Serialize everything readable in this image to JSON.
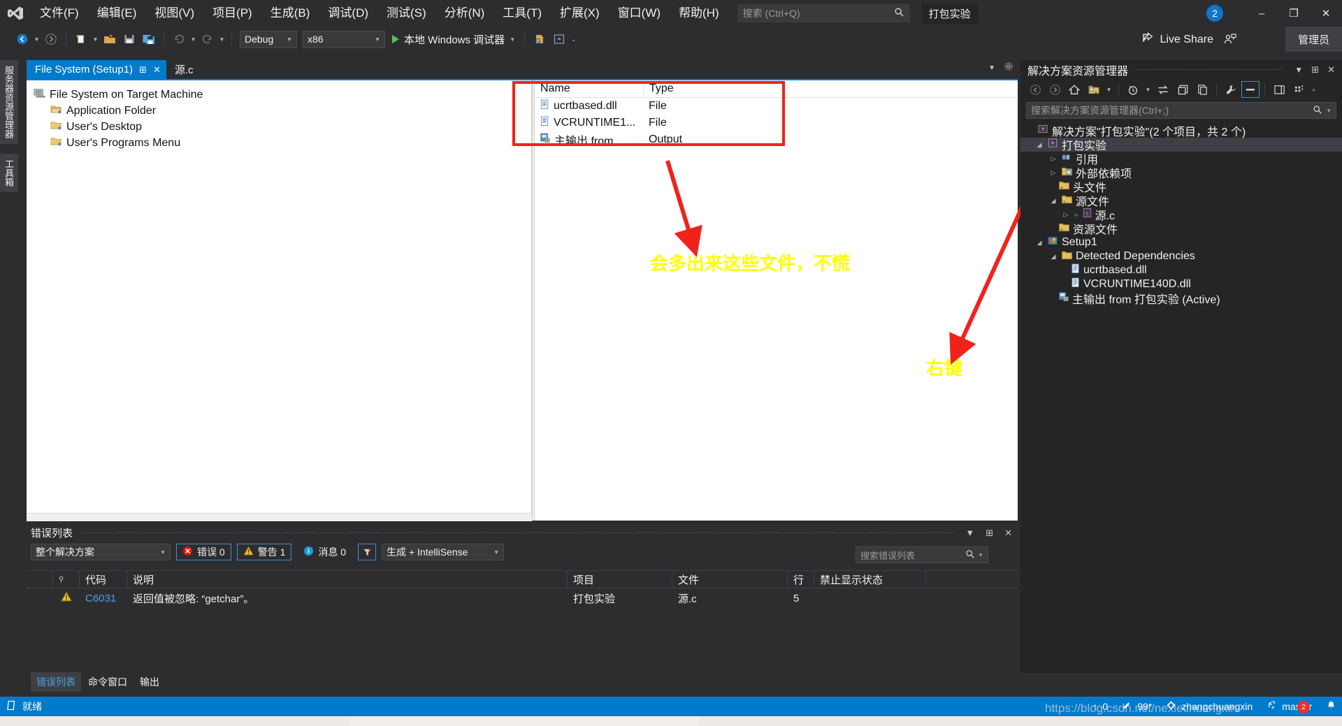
{
  "titlebar": {
    "logo": "vs-logo-icon",
    "menus": [
      "文件(F)",
      "编辑(E)",
      "视图(V)",
      "项目(P)",
      "生成(B)",
      "调试(D)",
      "测试(S)",
      "分析(N)",
      "工具(T)",
      "扩展(X)",
      "窗口(W)",
      "帮助(H)"
    ],
    "search_placeholder": "搜索 (Ctrl+Q)",
    "project_title": "打包实验",
    "notification_count": "2",
    "minimize": "–",
    "maximize": "❐",
    "close": "✕"
  },
  "toolbar": {
    "nav_back": "back-icon",
    "nav_forward": "forward-icon",
    "new_item": "new-item-icon",
    "open_file": "open-folder-icon",
    "save": "save-icon",
    "save_all": "save-all-icon",
    "undo": "undo-icon",
    "redo": "redo-icon",
    "config": "Debug",
    "platform": "x86",
    "run_label": "本地 Windows 调试器",
    "live_share": "Live Share",
    "admin": "管理员"
  },
  "vertical_tabs": [
    "服务器资源管理器",
    "工具箱"
  ],
  "document_tabs": [
    {
      "label": "File System (Setup1)",
      "active": true
    },
    {
      "label": "源.c",
      "active": false
    }
  ],
  "designer": {
    "tree": [
      {
        "label": "File System on Target Machine",
        "icon": "computer-icon",
        "indent": 0
      },
      {
        "label": "Application Folder",
        "icon": "folder-open-icon",
        "indent": 1
      },
      {
        "label": "User's Desktop",
        "icon": "folder-icon",
        "indent": 1
      },
      {
        "label": "User's Programs Menu",
        "icon": "folder-icon",
        "indent": 1
      }
    ],
    "list_headers": [
      "Name",
      "Type"
    ],
    "list_rows": [
      {
        "name": "ucrtbased.dll",
        "type": "File",
        "icon": "file-icon"
      },
      {
        "name": "VCRUNTIME1...",
        "type": "File",
        "icon": "file-icon"
      },
      {
        "name": "主输出 from ...",
        "type": "Output",
        "icon": "output-icon"
      }
    ]
  },
  "annotations": [
    {
      "text": "会多出来这些文件，不慌",
      "color": "#ffff00"
    },
    {
      "text": "右键",
      "color": "#ffff00"
    }
  ],
  "error_list": {
    "title": "错误列表",
    "scope": "整个解决方案",
    "errors_label": "错误 0",
    "warnings_label": "警告 1",
    "messages_label": "消息 0",
    "build_filter": "生成 + IntelliSense",
    "search_placeholder": "搜索错误列表",
    "columns": [
      "",
      "",
      "代码",
      "说明",
      "项目",
      "文件",
      "行",
      "禁止显示状态"
    ],
    "rows": [
      {
        "severity": "warning-icon",
        "code": "C6031",
        "description": "返回值被忽略: “getchar”。",
        "project": "打包实验",
        "file": "源.c",
        "line": "5",
        "suppression": ""
      }
    ],
    "bottom_tabs": [
      "错误列表",
      "命令窗口",
      "输出"
    ]
  },
  "solution_explorer": {
    "title": "解决方案资源管理器",
    "search_placeholder": "搜索解决方案资源管理器(Ctrl+;)",
    "toolbar_icons": [
      "back-icon",
      "forward-icon",
      "home-icon",
      "new-folder-icon",
      "pending-changes-icon",
      "sync-icon",
      "collapse-all-icon",
      "copy-icon",
      "properties-icon",
      "show-all-files-icon",
      "preview-icon",
      "view-options-icon"
    ],
    "tree": [
      {
        "label": "解决方案\"打包实验\"(2 个项目，共 2 个)",
        "indent": 0,
        "twisty": "none",
        "icon": "solution-icon",
        "selected": false
      },
      {
        "label": "打包实验",
        "indent": 1,
        "twisty": "open",
        "icon": "cpp-project-icon",
        "selected": true
      },
      {
        "label": "引用",
        "indent": 2,
        "twisty": "closed",
        "icon": "references-icon",
        "selected": false
      },
      {
        "label": "外部依赖项",
        "indent": 2,
        "twisty": "closed",
        "icon": "external-deps-icon",
        "selected": false
      },
      {
        "label": "头文件",
        "indent": 2,
        "twisty": "none",
        "icon": "filter-folder-icon",
        "selected": false
      },
      {
        "label": "源文件",
        "indent": 2,
        "twisty": "open",
        "icon": "filter-folder-icon",
        "selected": false
      },
      {
        "label": "源.c",
        "indent": 3,
        "twisty": "closed",
        "icon": "c-file-icon",
        "selected": false
      },
      {
        "label": "资源文件",
        "indent": 2,
        "twisty": "none",
        "icon": "filter-folder-icon",
        "selected": false
      },
      {
        "label": "Setup1",
        "indent": 1,
        "twisty": "open",
        "icon": "setup-project-icon",
        "selected": false
      },
      {
        "label": "Detected Dependencies",
        "indent": 2,
        "twisty": "open",
        "icon": "folder-icon",
        "selected": false
      },
      {
        "label": "ucrtbased.dll",
        "indent": 3,
        "twisty": "none",
        "icon": "file-icon",
        "selected": false
      },
      {
        "label": "VCRUNTIME140D.dll",
        "indent": 3,
        "twisty": "none",
        "icon": "file-icon",
        "selected": false
      },
      {
        "label": "主输出 from 打包实验 (Active)",
        "indent": 2,
        "twisty": "none",
        "icon": "output-icon",
        "selected": false
      }
    ]
  },
  "statusbar": {
    "state": "就绪",
    "up_count": "0",
    "pending_edits": "99*",
    "user": "zhangchuangxin",
    "branch": "master",
    "watermark": "https://blog.csdn.net/nexiechuangxin"
  },
  "colors": {
    "accent": "#007acc",
    "annotation": "#ffff00",
    "redbox": "#f0231c",
    "chrome": "#2d2d30",
    "panel": "#252526"
  }
}
